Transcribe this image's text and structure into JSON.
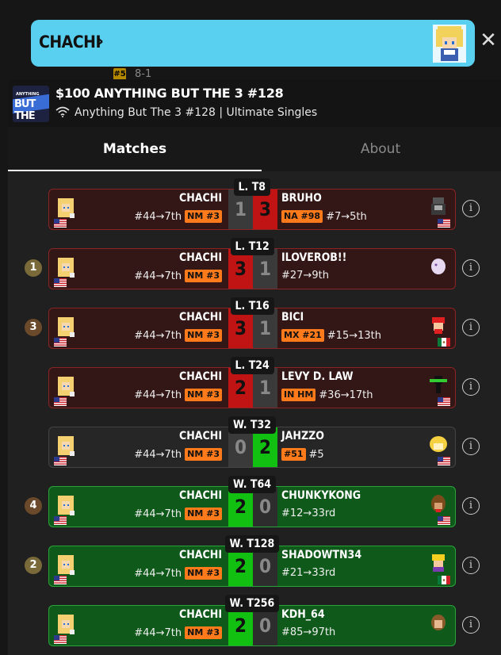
{
  "backdrop": {
    "tag": "#5",
    "text": "8-1"
  },
  "banner": {
    "player_name": "CHACHI",
    "chevron": "›",
    "close": "✕",
    "colors": {
      "bg": "#5ad0f0"
    }
  },
  "event": {
    "logo_line1": "ANYTHING",
    "logo_line2": "BUT THE",
    "title": "$100 ANYTHING BUT THE 3 #128",
    "subtitle": "Anything But The 3 #128 | Ultimate Singles",
    "online_icon": "wifi-icon"
  },
  "tabs": [
    {
      "label": "Matches",
      "active": true
    },
    {
      "label": "About",
      "active": false
    }
  ],
  "info_glyph": "i",
  "matches": [
    {
      "seed": "",
      "round": "L. T8",
      "result": "loss",
      "player": "CHACHI",
      "player_line": "#44→7th",
      "player_tag": "NM #3",
      "player_score": "1",
      "opp_score": "3",
      "left_style": "dim",
      "right_style": "red",
      "opponent": "BRUHO",
      "opp_tag": "NA #98",
      "opp_line": "#7→5th",
      "opp_flag": "us",
      "opp_char": "ganon"
    },
    {
      "seed": "1",
      "round": "L. T12",
      "result": "loss",
      "player": "CHACHI",
      "player_line": "#44→7th",
      "player_tag": "NM #3",
      "player_score": "3",
      "opp_score": "1",
      "left_style": "red",
      "right_style": "dim",
      "opponent": "ILOVEROB!!",
      "opp_tag": "",
      "opp_line": "#27→9th",
      "opp_flag": "",
      "opp_char": "ghost"
    },
    {
      "seed": "3",
      "round": "L. T16",
      "result": "loss",
      "player": "CHACHI",
      "player_line": "#44→7th",
      "player_tag": "NM #3",
      "player_score": "3",
      "opp_score": "1",
      "left_style": "red",
      "right_style": "dim",
      "opponent": "BICI",
      "opp_tag": "MX #21",
      "opp_line": "#15→13th",
      "opp_flag": "mx",
      "opp_char": "mario"
    },
    {
      "seed": "",
      "round": "L. T24",
      "result": "loss",
      "player": "CHACHI",
      "player_line": "#44→7th",
      "player_tag": "NM #3",
      "player_score": "2",
      "opp_score": "1",
      "left_style": "red",
      "right_style": "dim",
      "opponent": "LEVY D. LAW",
      "opp_tag": "IN HM",
      "opp_line": "#36→17th",
      "opp_flag": "us",
      "opp_char": "gnw"
    },
    {
      "seed": "",
      "round": "W. T32",
      "result": "plain",
      "player": "CHACHI",
      "player_line": "#44→7th",
      "player_tag": "NM #3",
      "player_score": "0",
      "opp_score": "2",
      "left_style": "dim",
      "right_style": "grn",
      "opponent": "JAHZZO",
      "opp_tag": "#51",
      "opp_line": "#5",
      "opp_flag": "us",
      "opp_char": "isabelle",
      "opp_win": true
    },
    {
      "seed": "4",
      "round": "W. T64",
      "result": "win",
      "player": "CHACHI",
      "player_line": "#44→7th",
      "player_tag": "NM #3",
      "player_score": "2",
      "opp_score": "0",
      "left_style": "grn",
      "right_style": "dim2",
      "opponent": "CHUNKYKONG",
      "opp_tag": "",
      "opp_line": "#12→33rd",
      "opp_flag": "us",
      "opp_char": "dk"
    },
    {
      "seed": "2",
      "round": "W. T128",
      "result": "win",
      "player": "CHACHI",
      "player_line": "#44→7th",
      "player_tag": "NM #3",
      "player_score": "2",
      "opp_score": "0",
      "left_style": "grn",
      "right_style": "dim2",
      "opponent": "SHADOWTN34",
      "opp_tag": "",
      "opp_line": "#21→33rd",
      "opp_flag": "mx",
      "opp_char": "wario"
    },
    {
      "seed": "",
      "round": "W. T256",
      "result": "win",
      "player": "CHACHI",
      "player_line": "#44→7th",
      "player_tag": "NM #3",
      "player_score": "2",
      "opp_score": "0",
      "left_style": "grn",
      "right_style": "dim2",
      "opponent": "KDH_64",
      "opp_tag": "",
      "opp_line": "#85→97th",
      "opp_flag": "",
      "opp_char": "dk2"
    }
  ]
}
